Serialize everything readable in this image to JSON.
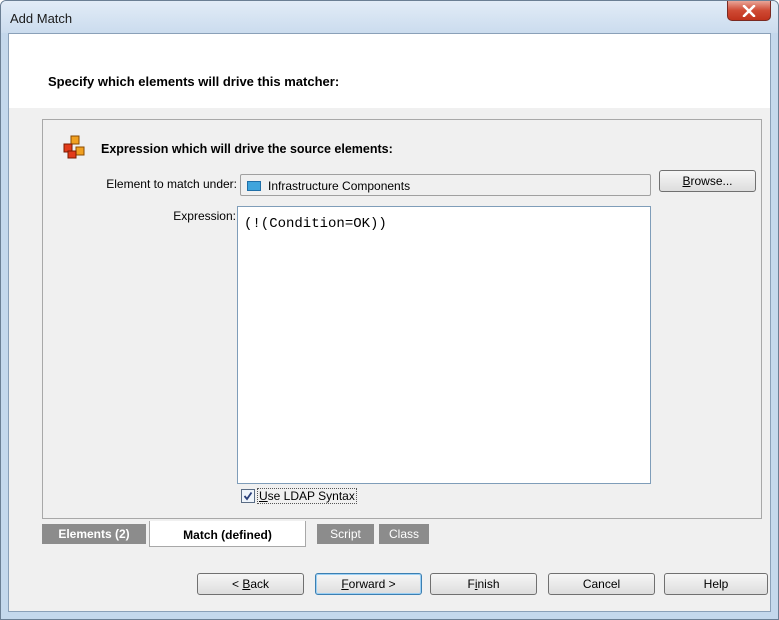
{
  "window": {
    "title": "Add Match",
    "close_glyph": "X"
  },
  "header": {
    "instruction": "Specify which elements will drive this matcher:"
  },
  "panel": {
    "icon": "element-group-icon",
    "title": "Expression which will drive the source elements:",
    "element_label": "Element to match under:",
    "element_value": "Infrastructure Components",
    "element_icon": "component-icon",
    "browse_label_u": "B",
    "browse_label_rest": "rowse...",
    "expression_label": "Expression:",
    "expression_value": "(!(Condition=OK))",
    "ldap_checked": true,
    "ldap_label_u": "U",
    "ldap_label_rest": "se LDAP Syntax"
  },
  "tabs": [
    {
      "label": "Elements (2)",
      "active": false
    },
    {
      "label": "Match (defined)",
      "active": true
    },
    {
      "label": "Script",
      "active": false
    },
    {
      "label": "Class",
      "active": false
    }
  ],
  "buttons": {
    "back_pre": "< ",
    "back_u": "B",
    "back_rest": "ack",
    "forward_u": "F",
    "forward_rest": "orward >",
    "finish_pre": "F",
    "finish_u": "i",
    "finish_rest": "nish",
    "cancel": "Cancel",
    "help": "Help"
  },
  "colors": {
    "window_frame": "#c4d8ec",
    "close_button": "#c9462f",
    "inactive_tab": "#8c8c8c",
    "active_tab": "#ffffff"
  }
}
